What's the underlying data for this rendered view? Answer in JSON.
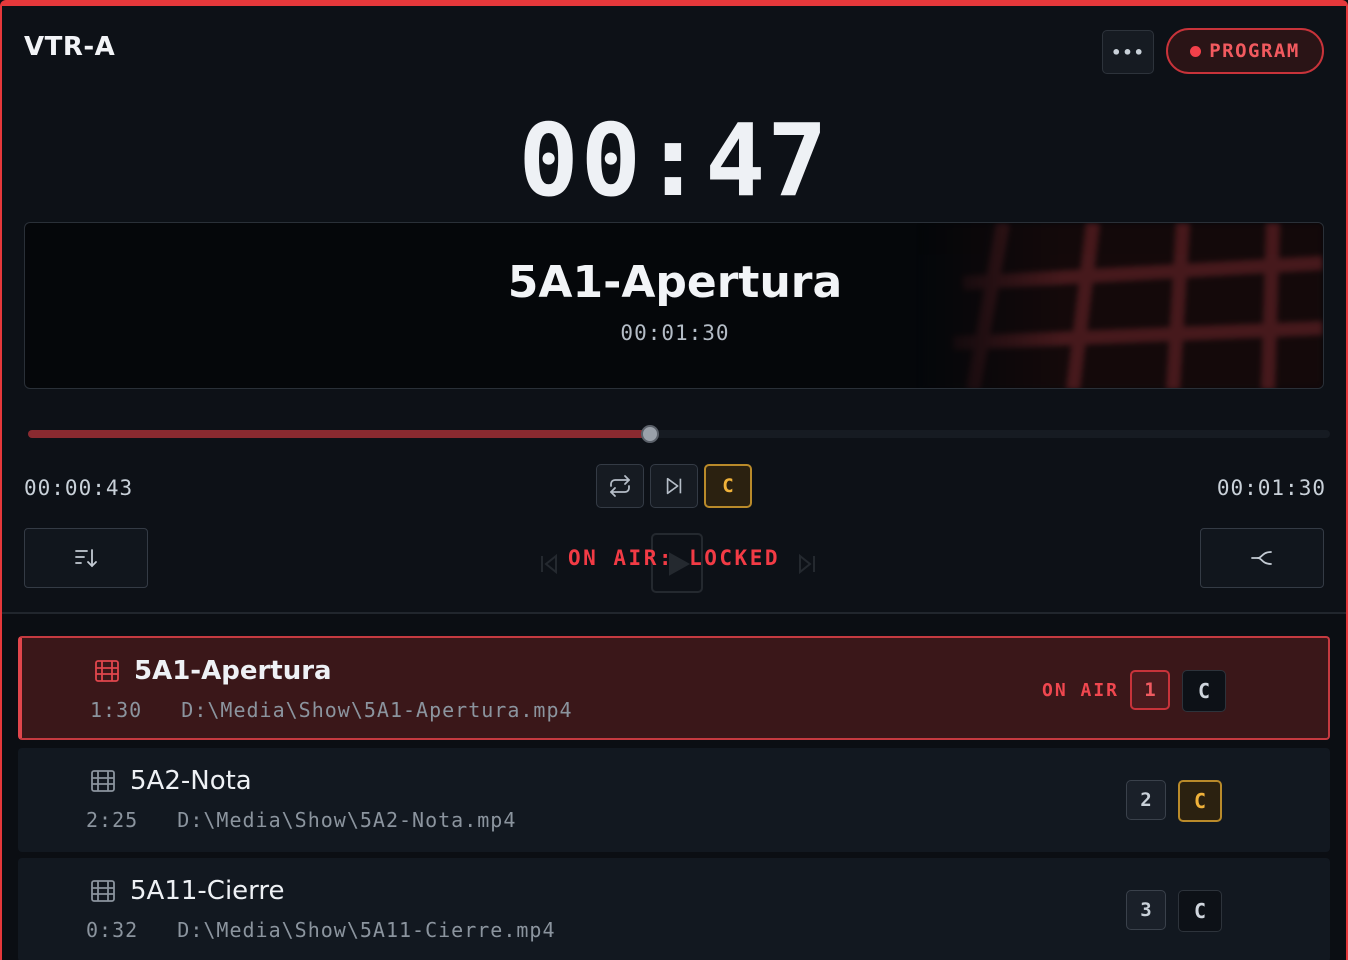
{
  "header": {
    "title": "VTR-A",
    "more_label": "•••",
    "program_label": "PROGRAM"
  },
  "player": {
    "countdown": "00:47",
    "clip_name": "5A1-Apertura",
    "clip_duration": "00:01:30",
    "elapsed": "00:00:43",
    "total": "00:01:30",
    "progress": 0.4778,
    "cue_label": "C",
    "status": "ON AIR: LOCKED"
  },
  "playlist": [
    {
      "name": "5A1-Apertura",
      "duration": "1:30",
      "path": "D:\\Media\\Show\\5A1-Apertura.mp4",
      "index": "1",
      "cue": "C",
      "on_air": "ON AIR",
      "active": true,
      "cue_armed": false
    },
    {
      "name": "5A2-Nota",
      "duration": "2:25",
      "path": "D:\\Media\\Show\\5A2-Nota.mp4",
      "index": "2",
      "cue": "C",
      "on_air": "",
      "active": false,
      "cue_armed": true
    },
    {
      "name": "5A11-Cierre",
      "duration": "0:32",
      "path": "D:\\Media\\Show\\5A11-Cierre.mp4",
      "index": "3",
      "cue": "C",
      "on_air": "",
      "active": false,
      "cue_armed": false
    }
  ],
  "colors": {
    "accent_red": "#e5383b",
    "cue_gold": "#f0b23a",
    "background": "#0d1117"
  },
  "icons": {
    "more": "more-dots-icon",
    "loop": "loop-icon",
    "next": "skip-next-icon",
    "sort": "sort-down-icon",
    "branch": "branch-icon",
    "film": "film-icon"
  }
}
